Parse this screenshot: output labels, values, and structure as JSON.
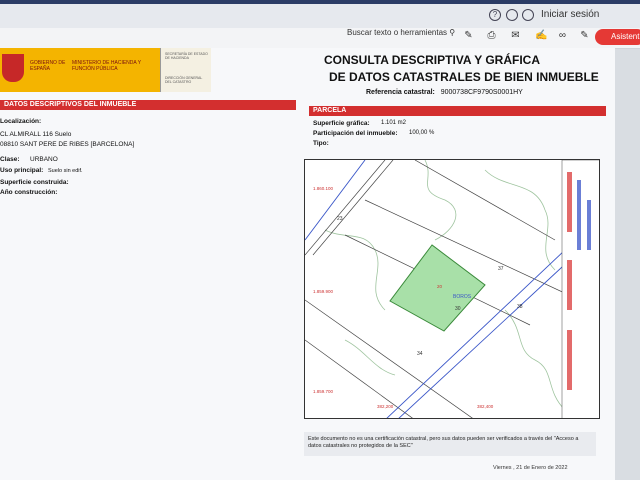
{
  "browser": {
    "login": "Iniciar sesión",
    "search_label": "Buscar texto o herramientas",
    "assistant_label": "Asistent"
  },
  "logo": {
    "line1": "GOBIERNO DE ESPAÑA",
    "line2": "MINISTERIO DE HACIENDA Y FUNCIÓN PÚBLICA",
    "small_top": "SECRETARÍA DE ESTADO DE HACIENDA",
    "small_bottom": "DIRECCIÓN GENERAL DEL CATASTRO"
  },
  "title": {
    "line1": "CONSULTA DESCRIPTIVA Y GRÁFICA",
    "line2": "DE DATOS CATASTRALES DE BIEN INMUEBLE",
    "ref_label": "Referencia catastral:",
    "ref_value": "9000738CF9790S0001HY"
  },
  "left": {
    "section": "DATOS DESCRIPTIVOS DEL INMUEBLE",
    "loc_label": "Localización:",
    "loc_line1": "CL ALMIRALL 116 Suelo",
    "loc_line2": "08810 SANT PERE DE RIBES [BARCELONA]",
    "clase_label": "Clase:",
    "clase_value": "URBANO",
    "uso_label": "Uso principal:",
    "uso_value": "Suelo sin edif.",
    "sup_label": "Superficie construida:",
    "anio_label": "Año construcción:"
  },
  "right": {
    "section": "PARCELA",
    "sup_label": "Superficie gráfica:",
    "sup_value": "1.101 m2",
    "part_label": "Participación del inmueble:",
    "part_value": "100,00 %",
    "tipo_label": "Tipo:"
  },
  "map": {
    "labels": [
      "1.860.100",
      "1.859.900",
      "1.859.700",
      "382,200",
      "382,400",
      "20",
      "30",
      "37",
      "38",
      "23",
      "34",
      "BOROS"
    ],
    "parcel_color": "#a8e0a8"
  },
  "note": {
    "text": "Este documento no es una certificación catastral, pero sus datos pueden ser verificados a través del \"Acceso a datos catastrales no protegidos de la SEC\"",
    "date": "Viernes , 21 de Enero de 2022"
  }
}
